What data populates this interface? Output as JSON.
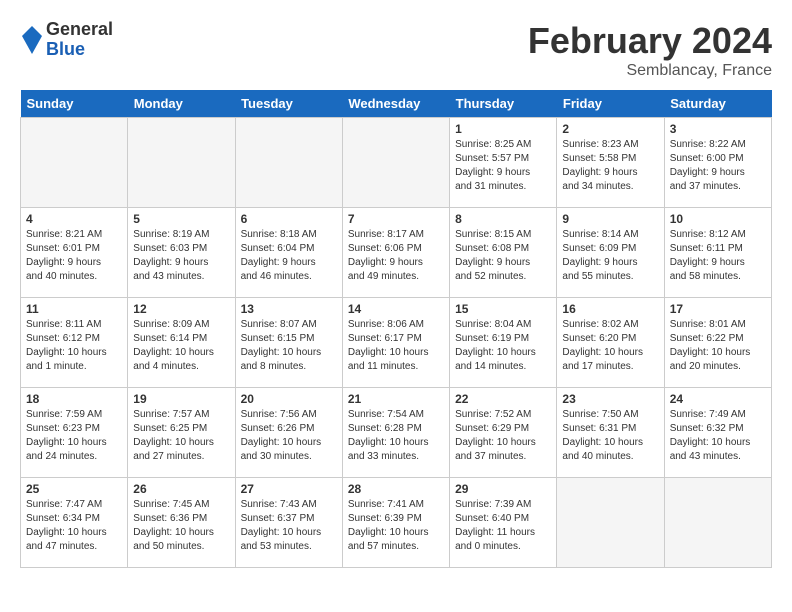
{
  "header": {
    "logo_general": "General",
    "logo_blue": "Blue",
    "month_title": "February 2024",
    "location": "Semblancay, France"
  },
  "days_of_week": [
    "Sunday",
    "Monday",
    "Tuesday",
    "Wednesday",
    "Thursday",
    "Friday",
    "Saturday"
  ],
  "weeks": [
    [
      {
        "day": "",
        "content": ""
      },
      {
        "day": "",
        "content": ""
      },
      {
        "day": "",
        "content": ""
      },
      {
        "day": "",
        "content": ""
      },
      {
        "day": "1",
        "content": "Sunrise: 8:25 AM\nSunset: 5:57 PM\nDaylight: 9 hours\nand 31 minutes."
      },
      {
        "day": "2",
        "content": "Sunrise: 8:23 AM\nSunset: 5:58 PM\nDaylight: 9 hours\nand 34 minutes."
      },
      {
        "day": "3",
        "content": "Sunrise: 8:22 AM\nSunset: 6:00 PM\nDaylight: 9 hours\nand 37 minutes."
      }
    ],
    [
      {
        "day": "4",
        "content": "Sunrise: 8:21 AM\nSunset: 6:01 PM\nDaylight: 9 hours\nand 40 minutes."
      },
      {
        "day": "5",
        "content": "Sunrise: 8:19 AM\nSunset: 6:03 PM\nDaylight: 9 hours\nand 43 minutes."
      },
      {
        "day": "6",
        "content": "Sunrise: 8:18 AM\nSunset: 6:04 PM\nDaylight: 9 hours\nand 46 minutes."
      },
      {
        "day": "7",
        "content": "Sunrise: 8:17 AM\nSunset: 6:06 PM\nDaylight: 9 hours\nand 49 minutes."
      },
      {
        "day": "8",
        "content": "Sunrise: 8:15 AM\nSunset: 6:08 PM\nDaylight: 9 hours\nand 52 minutes."
      },
      {
        "day": "9",
        "content": "Sunrise: 8:14 AM\nSunset: 6:09 PM\nDaylight: 9 hours\nand 55 minutes."
      },
      {
        "day": "10",
        "content": "Sunrise: 8:12 AM\nSunset: 6:11 PM\nDaylight: 9 hours\nand 58 minutes."
      }
    ],
    [
      {
        "day": "11",
        "content": "Sunrise: 8:11 AM\nSunset: 6:12 PM\nDaylight: 10 hours\nand 1 minute."
      },
      {
        "day": "12",
        "content": "Sunrise: 8:09 AM\nSunset: 6:14 PM\nDaylight: 10 hours\nand 4 minutes."
      },
      {
        "day": "13",
        "content": "Sunrise: 8:07 AM\nSunset: 6:15 PM\nDaylight: 10 hours\nand 8 minutes."
      },
      {
        "day": "14",
        "content": "Sunrise: 8:06 AM\nSunset: 6:17 PM\nDaylight: 10 hours\nand 11 minutes."
      },
      {
        "day": "15",
        "content": "Sunrise: 8:04 AM\nSunset: 6:19 PM\nDaylight: 10 hours\nand 14 minutes."
      },
      {
        "day": "16",
        "content": "Sunrise: 8:02 AM\nSunset: 6:20 PM\nDaylight: 10 hours\nand 17 minutes."
      },
      {
        "day": "17",
        "content": "Sunrise: 8:01 AM\nSunset: 6:22 PM\nDaylight: 10 hours\nand 20 minutes."
      }
    ],
    [
      {
        "day": "18",
        "content": "Sunrise: 7:59 AM\nSunset: 6:23 PM\nDaylight: 10 hours\nand 24 minutes."
      },
      {
        "day": "19",
        "content": "Sunrise: 7:57 AM\nSunset: 6:25 PM\nDaylight: 10 hours\nand 27 minutes."
      },
      {
        "day": "20",
        "content": "Sunrise: 7:56 AM\nSunset: 6:26 PM\nDaylight: 10 hours\nand 30 minutes."
      },
      {
        "day": "21",
        "content": "Sunrise: 7:54 AM\nSunset: 6:28 PM\nDaylight: 10 hours\nand 33 minutes."
      },
      {
        "day": "22",
        "content": "Sunrise: 7:52 AM\nSunset: 6:29 PM\nDaylight: 10 hours\nand 37 minutes."
      },
      {
        "day": "23",
        "content": "Sunrise: 7:50 AM\nSunset: 6:31 PM\nDaylight: 10 hours\nand 40 minutes."
      },
      {
        "day": "24",
        "content": "Sunrise: 7:49 AM\nSunset: 6:32 PM\nDaylight: 10 hours\nand 43 minutes."
      }
    ],
    [
      {
        "day": "25",
        "content": "Sunrise: 7:47 AM\nSunset: 6:34 PM\nDaylight: 10 hours\nand 47 minutes."
      },
      {
        "day": "26",
        "content": "Sunrise: 7:45 AM\nSunset: 6:36 PM\nDaylight: 10 hours\nand 50 minutes."
      },
      {
        "day": "27",
        "content": "Sunrise: 7:43 AM\nSunset: 6:37 PM\nDaylight: 10 hours\nand 53 minutes."
      },
      {
        "day": "28",
        "content": "Sunrise: 7:41 AM\nSunset: 6:39 PM\nDaylight: 10 hours\nand 57 minutes."
      },
      {
        "day": "29",
        "content": "Sunrise: 7:39 AM\nSunset: 6:40 PM\nDaylight: 11 hours\nand 0 minutes."
      },
      {
        "day": "",
        "content": ""
      },
      {
        "day": "",
        "content": ""
      }
    ]
  ]
}
